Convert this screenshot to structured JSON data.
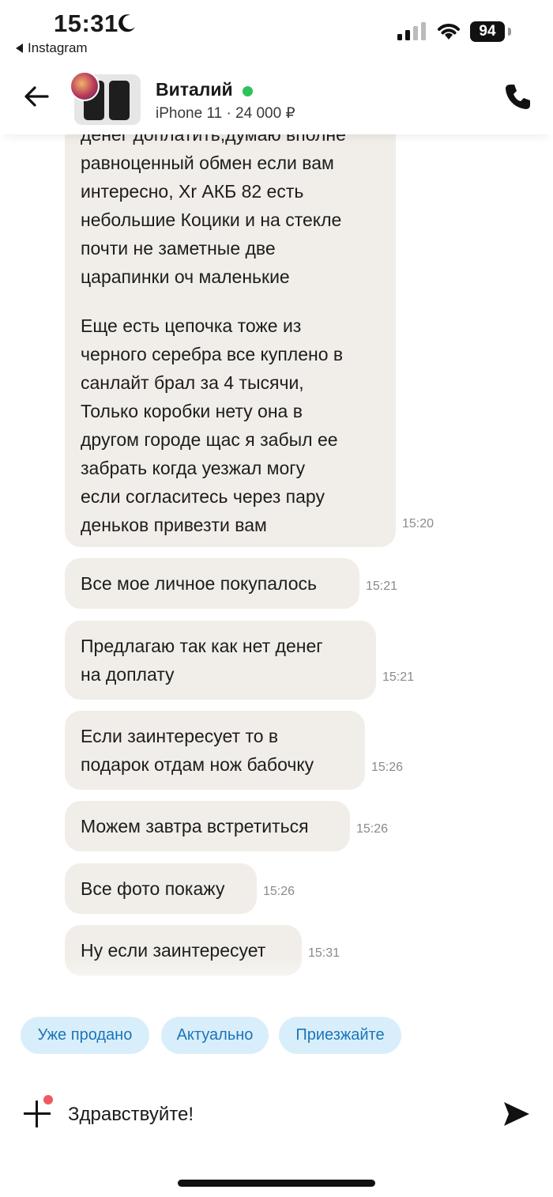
{
  "status_bar": {
    "time": "15:31",
    "back_app": "Instagram",
    "battery": "94",
    "icons": [
      "moon-icon",
      "signal-icon",
      "wifi-icon",
      "battery-icon"
    ]
  },
  "header": {
    "contact_name": "Виталий",
    "online": true,
    "listing": "iPhone 11 · 24 000 ₽",
    "icons": [
      "back-arrow-icon",
      "phone-icon"
    ]
  },
  "messages": [
    {
      "text": "денег доплатить,думаю вполне\nравноценный обмен если вам\nинтересно, Xr АКБ 82 есть\nнебольшие Коцики и на стекле\nпочти не заметные две\nцарапинки оч маленькие",
      "text2": "Еще есть цепочка тоже из\nчерного серебра все куплено в\nсанлайт брал за 4 тысячи,\nТолько коробки нету она в\nдругом городе щас я забыл ее\nзабрать когда уезжал могу\nесли согласитесь через пару\nденьков привезти вам",
      "time": "15:20"
    },
    {
      "text": "Все мое личное покупалось",
      "time": "15:21"
    },
    {
      "text": "Предлагаю так как нет денег\nна доплату",
      "time": "15:21"
    },
    {
      "text": "Если заинтересует то в\nподарок отдам нож бабочку",
      "time": "15:26"
    },
    {
      "text": "Можем завтра встретиться",
      "time": "15:26"
    },
    {
      "text": "Все фото покажу",
      "time": "15:26"
    },
    {
      "text": "Ну если заинтересует",
      "time": "15:31"
    }
  ],
  "quick_replies": [
    "Уже продано",
    "Актуально",
    "Приезжайте"
  ],
  "composer": {
    "value": "Здравствуйте!",
    "icons": [
      "plus-icon",
      "send-icon"
    ]
  },
  "colors": {
    "bubble": "#f1eee9",
    "chip_bg": "#d9eefb",
    "chip_text": "#1c74b8",
    "online": "#2dc25a",
    "notification": "#f05a5f"
  }
}
